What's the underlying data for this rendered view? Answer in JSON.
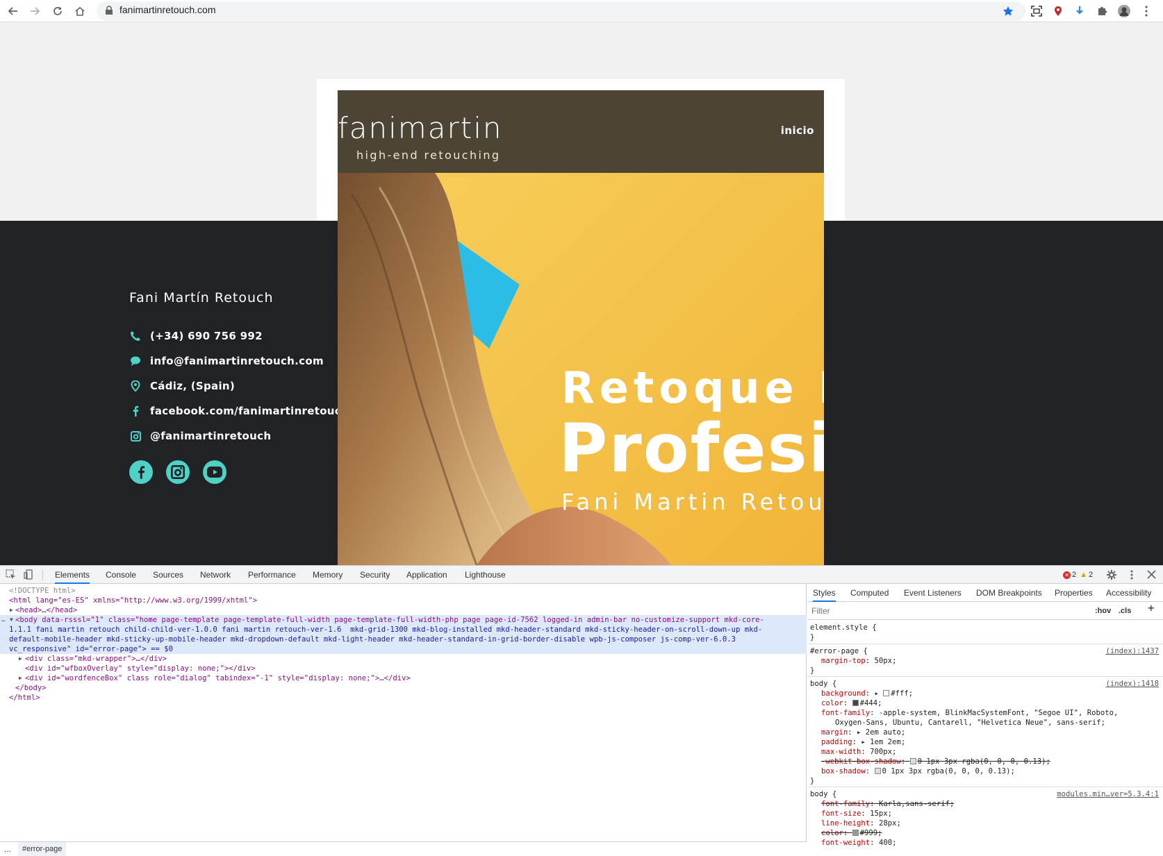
{
  "browser": {
    "url": "fanimartinretouch.com"
  },
  "page": {
    "logo": {
      "main": "fanimartin",
      "sub": "high-end retouching"
    },
    "nav": {
      "home": "inicio"
    },
    "hero": {
      "line1": "Retoque D",
      "line2": "Profesi",
      "line3": "Fani Martin Retou"
    },
    "footer": {
      "title": "Fani Martín Retouch",
      "contacts": [
        {
          "icon": "phone-icon",
          "text": "(+34) 690 756 992"
        },
        {
          "icon": "chat-icon",
          "text": "info@fanimartinretouch.com"
        },
        {
          "icon": "location-pin-icon",
          "text": "Cádiz, (Spain)"
        },
        {
          "icon": "facebook-icon",
          "text": "facebook.com/fanimartinretouch"
        },
        {
          "icon": "instagram-icon",
          "text": "@fanimartinretouch"
        }
      ],
      "social": [
        "facebook-circle-icon",
        "instagram-circle-icon",
        "youtube-circle-icon"
      ]
    },
    "colors": {
      "accent": "#4fd1c5",
      "dark": "#212226",
      "hero_bg": "#f6cc52",
      "header_bg": "#4c4536"
    }
  },
  "devtools": {
    "tabs": [
      "Elements",
      "Console",
      "Sources",
      "Network",
      "Performance",
      "Memory",
      "Security",
      "Application",
      "Lighthouse"
    ],
    "errors": "2",
    "warnings": "2",
    "dom": {
      "doctype": "<!DOCTYPE html>",
      "html_open": "<html lang=\"es-ES\" xmlns=\"http://www.w3.org/1999/xhtml\">",
      "head": "<head>…</head>",
      "body_line1": "<body data-rsssl=\"1\" class=\"home page-template page-template-full-width page-template-full-width-php page page-id-7562 logged-in admin-bar no-customize-support mkd-core-",
      "body_line2": "1.1.1 fani martin retouch child-child-ver-1.0.0 fani martin retouch-ver-1.6  mkd-grid-1300 mkd-blog-installed mkd-header-standard mkd-sticky-header-on-scroll-down-up mkd-",
      "body_line3": "default-mobile-header mkd-sticky-up-mobile-header mkd-dropdown-default mkd-light-header mkd-header-standard-in-grid-border-disable wpb-js-composer js-comp-ver-6.0.3",
      "body_line4": "vc_responsive\" id=\"error-page\"> == $0",
      "child1": "<div class=\"mkd-wrapper\">…</div>",
      "child2": "<div id=\"wfboxOverlay\" style=\"display: none;\"></div>",
      "child3": "<div id=\"wordfenceBox\" class role=\"dialog\" tabindex=\"-1\" style=\"display: none;\">…</div>",
      "body_close": "</body>",
      "html_close": "</html>"
    },
    "breadcrumb": "#error-page",
    "breadcrumb_more": "...",
    "styles": {
      "tabs": [
        "Styles",
        "Computed",
        "Event Listeners",
        "DOM Breakpoints",
        "Properties",
        "Accessibility"
      ],
      "filter_placeholder": "Filter",
      "hov": ":hov",
      "cls": ".cls",
      "rules": {
        "element_style": "element.style {",
        "error_page_sel": "#error-page {",
        "error_page_src": "(index):1437",
        "error_page_prop": "margin-top",
        "error_page_val": "50px;",
        "body1_sel": "body {",
        "body1_src": "(index):1418",
        "body1_props": [
          {
            "p": "background",
            "v": "#fff;"
          },
          {
            "p": "color",
            "v": "#444;"
          },
          {
            "p": "font-family",
            "v": "-apple-system, BlinkMacSystemFont, \"Segoe UI\", Roboto,"
          },
          {
            "p": "",
            "v": "Oxygen-Sans, Ubuntu, Cantarell, \"Helvetica Neue\", sans-serif;"
          },
          {
            "p": "margin",
            "v": "2em auto;"
          },
          {
            "p": "padding",
            "v": "1em 2em;"
          },
          {
            "p": "max-width",
            "v": "700px;"
          },
          {
            "p": "-webkit-box-shadow",
            "v": "0 1px 3px rgba(0, 0, 0, 0.13);"
          },
          {
            "p": "box-shadow",
            "v": "0 1px 3px rgba(0, 0, 0, 0.13);"
          }
        ],
        "body2_sel": "body {",
        "body2_src": "modules.min…ver=5.3.4:1",
        "body2_props": [
          {
            "p": "font-family",
            "v": "Karla,sans-serif;"
          },
          {
            "p": "font-size",
            "v": "15px;"
          },
          {
            "p": "line-height",
            "v": "28px;"
          },
          {
            "p": "color",
            "v": "#999;"
          },
          {
            "p": "font-weight",
            "v": "400;"
          }
        ]
      }
    }
  }
}
